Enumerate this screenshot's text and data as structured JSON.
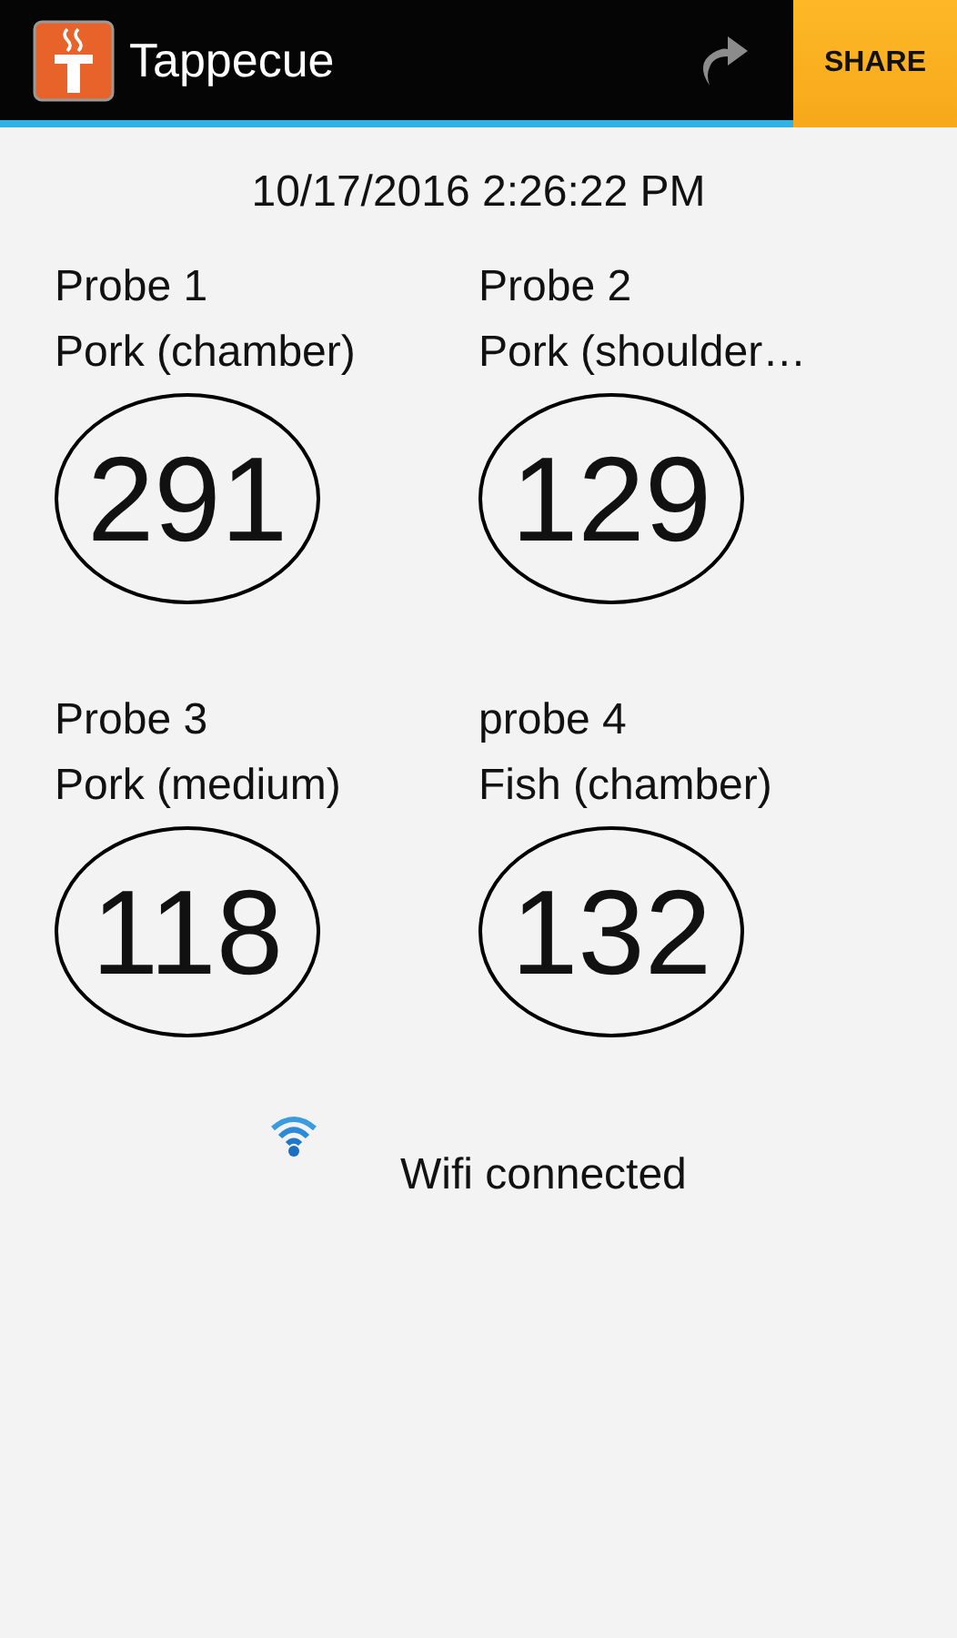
{
  "app_bar": {
    "title": "Tappecue",
    "share_button": "SHARE"
  },
  "timestamp": "10/17/2016 2:26:22 PM",
  "probes": [
    {
      "name": "Probe 1",
      "label": "Pork (chamber)",
      "temperature": "291"
    },
    {
      "name": "Probe 2",
      "label": "Pork (shoulder…",
      "temperature": "129"
    },
    {
      "name": "Probe 3",
      "label": "Pork (medium)",
      "temperature": "118"
    },
    {
      "name": "probe 4",
      "label": "Fish (chamber)",
      "temperature": "132"
    }
  ],
  "status": {
    "wifi_connected": true,
    "text": "Wifi connected"
  }
}
